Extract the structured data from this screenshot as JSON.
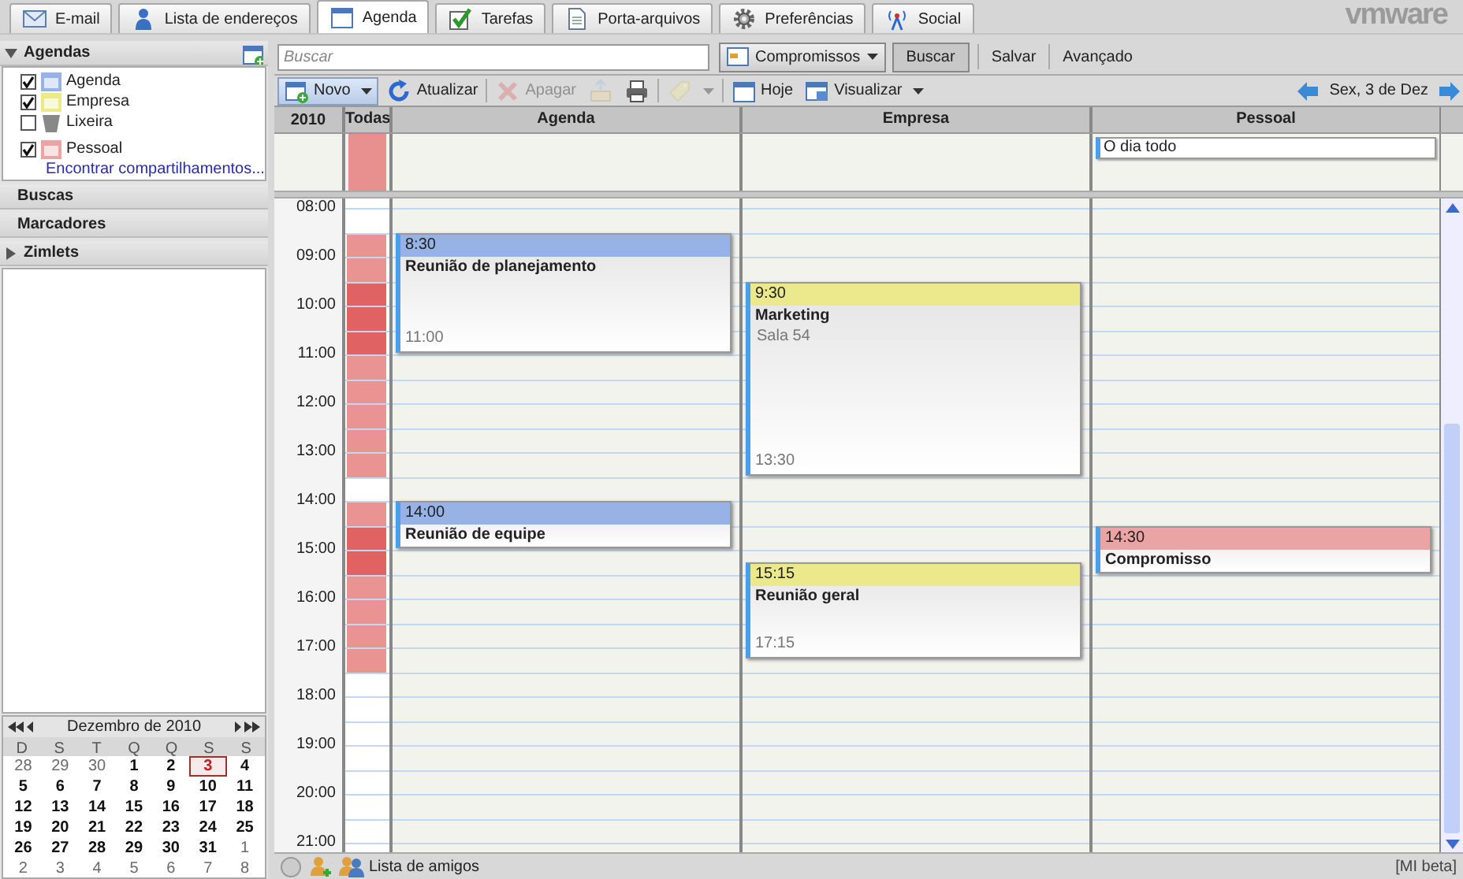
{
  "app_tabs": [
    {
      "label": "E-mail",
      "selected": false
    },
    {
      "label": "Lista de endereços",
      "selected": false
    },
    {
      "label": "Agenda",
      "selected": true
    },
    {
      "label": "Tarefas",
      "selected": false
    },
    {
      "label": "Porta-arquivos",
      "selected": false
    },
    {
      "label": "Preferências",
      "selected": false
    },
    {
      "label": "Social",
      "selected": false
    }
  ],
  "logo": "vmware",
  "sidebar": {
    "sections": [
      {
        "title": "Agendas",
        "expanded": true
      },
      {
        "title": "Buscas"
      },
      {
        "title": "Marcadores"
      },
      {
        "title": "Zimlets",
        "expanded": false
      }
    ],
    "calendars": [
      {
        "label": "Agenda",
        "kind": "calendar",
        "checked": true,
        "color": "#97b3e6"
      },
      {
        "label": "Empresa",
        "kind": "calendar",
        "checked": true,
        "color": "#ece98c"
      },
      {
        "label": "Lixeira",
        "kind": "trash",
        "checked": false
      },
      {
        "label": "Pessoal",
        "kind": "calendar",
        "checked": true,
        "color": "#eba4a4"
      }
    ],
    "find_link": "Encontrar compartilhamentos..."
  },
  "search": {
    "placeholder": "Buscar",
    "scope": "Compromissos",
    "buttons": [
      "Buscar",
      "Salvar",
      "Avançado"
    ]
  },
  "toolbar": {
    "items": [
      {
        "label": "Novo",
        "menu": true,
        "disabled": false
      },
      {
        "label": "Atualizar",
        "menu": false,
        "disabled": false
      },
      {
        "label": "Apagar",
        "menu": false,
        "disabled": true
      },
      {
        "menu": false,
        "disabled": true
      },
      {
        "menu": false,
        "disabled": false
      },
      {
        "menu": true,
        "disabled": true
      },
      {
        "label": "Hoje",
        "menu": false,
        "disabled": false
      },
      {
        "label": "Visualizar",
        "menu": true,
        "disabled": false
      }
    ],
    "date": "Sex, 3 de Dez"
  },
  "calendar_view": {
    "year": "2010",
    "all_label": "Todas",
    "hours": [
      "08:00",
      "09:00",
      "10:00",
      "11:00",
      "12:00",
      "13:00",
      "14:00",
      "15:00",
      "16:00",
      "17:00",
      "18:00",
      "19:00",
      "20:00",
      "21:00"
    ],
    "columns": [
      {
        "name": "Agenda",
        "color": "#97b3e6",
        "events": [
          {
            "start": "8:30",
            "end": "11:00",
            "title": "Reunião de planejamento"
          },
          {
            "start": "14:00",
            "title": "Reunião de equipe"
          }
        ]
      },
      {
        "name": "Empresa",
        "color": "#ece98c",
        "events": [
          {
            "start": "9:30",
            "end": "13:30",
            "title": "Marketing",
            "location": "Sala 54"
          },
          {
            "start": "15:15",
            "end": "17:15",
            "title": "Reunião geral"
          }
        ]
      },
      {
        "name": "Pessoal",
        "color": "#eba4a4",
        "all_day": [
          "O dia todo"
        ],
        "events": [
          {
            "start": "14:30",
            "title": "Compromisso"
          }
        ]
      }
    ]
  },
  "mini_calendar": {
    "title": "Dezembro de 2010",
    "weekdays": [
      "D",
      "S",
      "T",
      "Q",
      "Q",
      "S",
      "S"
    ],
    "weeks": [
      [
        {
          "d": "28",
          "outside": true,
          "selected": false
        },
        {
          "d": "29",
          "outside": true,
          "selected": false
        },
        {
          "d": "30",
          "outside": true,
          "selected": false
        },
        {
          "d": "1",
          "outside": false,
          "selected": false
        },
        {
          "d": "2",
          "outside": false,
          "selected": false
        },
        {
          "d": "3",
          "outside": false,
          "selected": true
        },
        {
          "d": "4",
          "outside": false,
          "selected": false
        }
      ],
      [
        {
          "d": "5",
          "outside": false,
          "selected": false
        },
        {
          "d": "6",
          "outside": false,
          "selected": false
        },
        {
          "d": "7",
          "outside": false,
          "selected": false
        },
        {
          "d": "8",
          "outside": false,
          "selected": false
        },
        {
          "d": "9",
          "outside": false,
          "selected": false
        },
        {
          "d": "10",
          "outside": false,
          "selected": false
        },
        {
          "d": "11",
          "outside": false,
          "selected": false
        }
      ],
      [
        {
          "d": "12",
          "outside": false,
          "selected": false
        },
        {
          "d": "13",
          "outside": false,
          "selected": false
        },
        {
          "d": "14",
          "outside": false,
          "selected": false
        },
        {
          "d": "15",
          "outside": false,
          "selected": false
        },
        {
          "d": "16",
          "outside": false,
          "selected": false
        },
        {
          "d": "17",
          "outside": false,
          "selected": false
        },
        {
          "d": "18",
          "outside": false,
          "selected": false
        }
      ],
      [
        {
          "d": "19",
          "outside": false,
          "selected": false
        },
        {
          "d": "20",
          "outside": false,
          "selected": false
        },
        {
          "d": "21",
          "outside": false,
          "selected": false
        },
        {
          "d": "22",
          "outside": false,
          "selected": false
        },
        {
          "d": "23",
          "outside": false,
          "selected": false
        },
        {
          "d": "24",
          "outside": false,
          "selected": false
        },
        {
          "d": "25",
          "outside": false,
          "selected": false
        }
      ],
      [
        {
          "d": "26",
          "outside": false,
          "selected": false
        },
        {
          "d": "27",
          "outside": false,
          "selected": false
        },
        {
          "d": "28",
          "outside": false,
          "selected": false
        },
        {
          "d": "29",
          "outside": false,
          "selected": false
        },
        {
          "d": "30",
          "outside": false,
          "selected": false
        },
        {
          "d": "31",
          "outside": false,
          "selected": false
        },
        {
          "d": "1",
          "outside": true,
          "selected": false
        }
      ],
      [
        {
          "d": "2",
          "outside": true,
          "selected": false
        },
        {
          "d": "3",
          "outside": true,
          "selected": false
        },
        {
          "d": "4",
          "outside": true,
          "selected": false
        },
        {
          "d": "5",
          "outside": true,
          "selected": false
        },
        {
          "d": "6",
          "outside": true,
          "selected": false
        },
        {
          "d": "7",
          "outside": true,
          "selected": false
        },
        {
          "d": "8",
          "outside": true,
          "selected": false
        }
      ]
    ]
  },
  "status_bar": {
    "buddy_list": "Lista de amigos",
    "badge": "[MI beta]"
  }
}
